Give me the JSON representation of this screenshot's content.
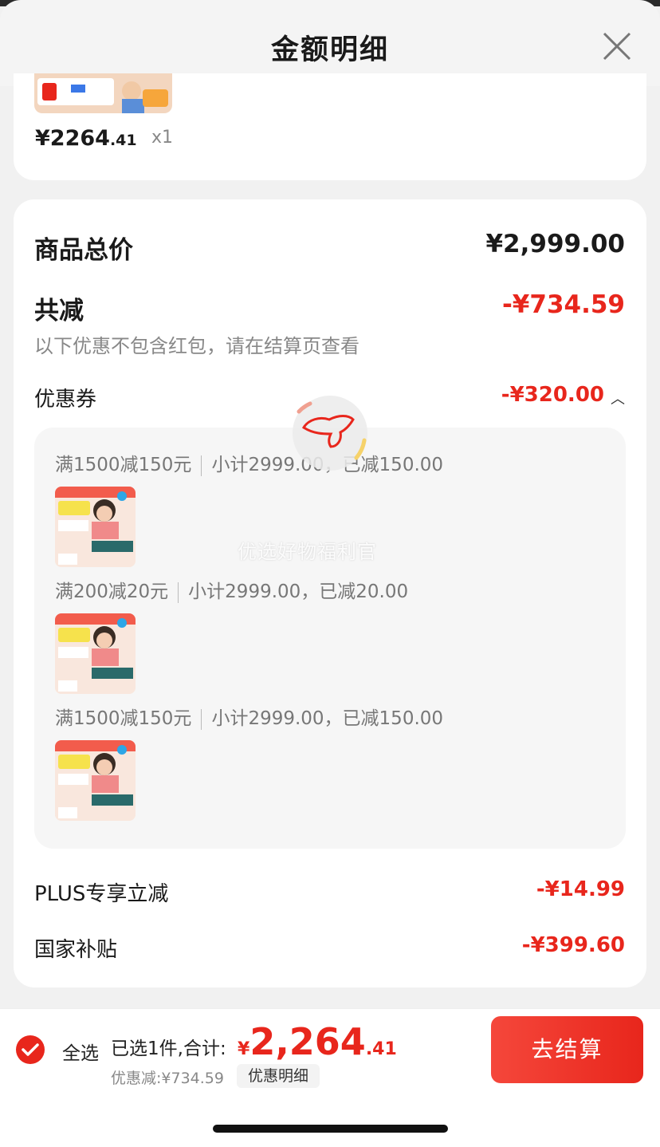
{
  "header": {
    "title": "金额明细"
  },
  "product": {
    "price_int": "¥2264",
    "price_dec": ".41",
    "qty": "x1"
  },
  "summary": {
    "goods_total_label": "商品总价",
    "goods_total_value": "¥2,999.00",
    "reduce_label": "共减",
    "reduce_value": "-¥734.59",
    "note": "以下优惠不包含红包，请在结算页查看",
    "coupon_label": "优惠券",
    "coupon_value": "-¥320.00"
  },
  "coupons": [
    {
      "rule": "满1500减150元",
      "detail": "小计2999.00，已减150.00"
    },
    {
      "rule": "满200减20元",
      "detail": "小计2999.00，已减20.00"
    },
    {
      "rule": "满1500减150元",
      "detail": "小计2999.00，已减150.00"
    }
  ],
  "watermark": "优选好物福利官",
  "extra_discounts": [
    {
      "label": "PLUS专享立减",
      "value": "-¥14.99"
    },
    {
      "label": "国家补贴",
      "value": "-¥399.60"
    }
  ],
  "footer": {
    "select_all": "全选",
    "selected_info": "已选1件,合计:",
    "total_currency": "¥",
    "total_int": "2,264",
    "total_dec": ".41",
    "discount_text": "优惠减:¥734.59",
    "detail_button": "优惠明细",
    "checkout_button": "去结算"
  },
  "colors": {
    "accent": "#e8261c"
  }
}
